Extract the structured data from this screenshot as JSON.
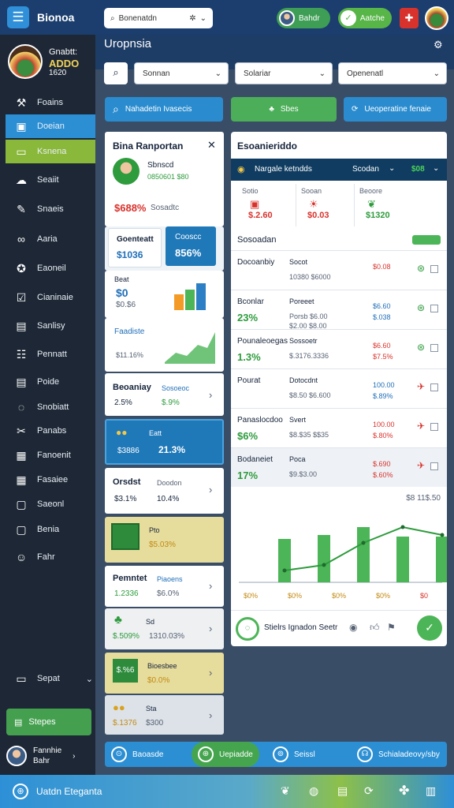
{
  "header": {
    "app_name": "Bionoa",
    "search_value": "Bonenatdn",
    "pill_a": "Bahdr",
    "pill_b": "Aatche"
  },
  "brand": {
    "line1": "Gnabtt:",
    "line2": "ADDO",
    "line3": "1620"
  },
  "sidebar": {
    "items": [
      {
        "label": "Foains",
        "icon": "wrench-icon",
        "glyph": "⚒"
      },
      {
        "label": "Doeian",
        "icon": "monitor-icon",
        "glyph": "▣"
      },
      {
        "label": "Ksnena",
        "icon": "laptop-icon",
        "glyph": "▭"
      },
      {
        "label": "Seaiit",
        "icon": "cloud-icon",
        "glyph": "☁"
      },
      {
        "label": "Snaeis",
        "icon": "pen-icon",
        "glyph": "✎"
      },
      {
        "label": "Aaria",
        "icon": "link-icon",
        "glyph": "∞"
      },
      {
        "label": "Eaoneil",
        "icon": "badge-icon",
        "glyph": "✪"
      },
      {
        "label": "Cianinaie",
        "icon": "report-icon",
        "glyph": "☑"
      },
      {
        "label": "Sanlisy",
        "icon": "folder-icon",
        "glyph": "▤"
      },
      {
        "label": "Pennatt",
        "icon": "checklist-icon",
        "glyph": "☷"
      },
      {
        "label": "Poide",
        "icon": "document-icon",
        "glyph": "▤"
      },
      {
        "label": "Snobiatt",
        "icon": "chat-icon",
        "glyph": "◌"
      },
      {
        "label": "Panabs",
        "icon": "tools-icon",
        "glyph": "✂"
      },
      {
        "label": "Fanoenit",
        "icon": "calendar-icon",
        "glyph": "▦"
      },
      {
        "label": "Fasaiee",
        "icon": "grid-icon",
        "glyph": "▦"
      },
      {
        "label": "Saeonl",
        "icon": "box-icon",
        "glyph": "▢"
      },
      {
        "label": "Benia",
        "icon": "square-icon",
        "glyph": "▢"
      },
      {
        "label": "Fahr",
        "icon": "person-icon",
        "glyph": "☺"
      }
    ],
    "group_label": "Sepat",
    "bottom_button": "Stepes",
    "user_name": "Fannhie",
    "user_sub": "Bahr"
  },
  "main": {
    "title": "Uropnsia",
    "filters": {
      "sel1": "Sonnan",
      "sel2": "Solariar",
      "sel3": "Openenatl"
    },
    "actions": {
      "a1": "Nahadetin Ivasecis",
      "a2": "Sbes",
      "a3": "Ueoperatine fenaie"
    }
  },
  "leftcol": {
    "profile": {
      "title": "Bina Ranportan",
      "name": "Sbnscd",
      "id": "0850601 $80",
      "big": "$688%",
      "big_sub": "Sosadtc"
    },
    "kpi_a": {
      "label": "Goenteatt",
      "value": "$1036"
    },
    "kpi_b": {
      "label": "Cooscc",
      "value": "856%"
    },
    "mini_chart": {
      "label": "Beat",
      "value": "$0",
      "sub": "$0.$6"
    },
    "trend": {
      "label": "Faadiste",
      "sub": "$11.16%"
    },
    "row1": {
      "title": "Beoaniay",
      "sub": "Sosoeoc",
      "v1": "2.5%",
      "v2": "$.9%"
    },
    "row2": {
      "label": "Eatt",
      "v1": "$3886",
      "v2": "21.3%"
    },
    "row3": {
      "title": "Orsdst",
      "sub": "Doodon",
      "v1": "$3.1%",
      "v2": "10.4%"
    },
    "row4": {
      "label": "Pto",
      "v1": "$5.03%"
    },
    "row5": {
      "title": "Pemntet",
      "sub": "Piaoens",
      "v1": "1.2336",
      "v2": "$6.0%"
    },
    "row6": {
      "label": "Sd",
      "v1": "$.509%",
      "v2": "1310.03%"
    },
    "row7": {
      "label": "Bioesbee",
      "v1": "$.%6",
      "v2": "$0.0%"
    },
    "row8": {
      "label": "Sta",
      "v1": "$.1376",
      "v2": "$300"
    }
  },
  "panel": {
    "title": "Esoanieriddo",
    "band_label": "Nargale ketndds",
    "band_sel": "Scodan",
    "band_value": "$08",
    "stats": [
      {
        "label": "Sotio",
        "value": "$.2.60",
        "color": "#d8322c"
      },
      {
        "label": "Sooan",
        "value": "$0.03",
        "color": "#d8322c"
      },
      {
        "label": "Beoore",
        "value": "$1320",
        "color": "#2e9b3d"
      }
    ],
    "section": "Sosoadan",
    "rows": [
      {
        "name": "Docoanbiy",
        "sub": "Socot",
        "pct": "",
        "mid": "10380 $6000",
        "right": "$0.08",
        "rcolor": "#d8322c",
        "icon": "green"
      },
      {
        "name": "Bconlar",
        "sub": "Poreeet",
        "pct": "23%",
        "mid": "Porsb $6.00 $2.00 $8.00",
        "right": "$6.60 $.038",
        "rcolor": "#1f6eb8",
        "icon": "green"
      },
      {
        "name": "Pounaleoegas",
        "sub": "Sossoetr",
        "pct": "1.3%",
        "mid": "$.3176.3336",
        "right": "$6.60 $7.5%",
        "rcolor": "#d8322c",
        "icon": "green"
      },
      {
        "name": "Pourat",
        "sub": "Dotocdnt",
        "pct": "",
        "mid": "$8.50 $6.600",
        "right": "100.00 $.89%",
        "rcolor": "#1f6eb8",
        "icon": "red"
      },
      {
        "name": "Panaslocdoo",
        "sub": "Svert",
        "pct": "$6%",
        "mid": "$8.$35 $$35",
        "right": "100.00 $.80%",
        "rcolor": "#d8322c",
        "icon": "red"
      },
      {
        "name": "Bodaneiet",
        "sub": "Poca",
        "pct": "17%",
        "mid": "$9.$3.00",
        "right": "$.690 $.60%",
        "rcolor": "#d8322c",
        "icon": "red"
      }
    ],
    "chart_top_value": "$8 11$.50",
    "chart_labels": [
      "$0%",
      "$0%",
      "$0%",
      "$0%",
      "$0"
    ],
    "footer": "Stielrs Ignadon Seetr"
  },
  "chart_data": {
    "type": "bar",
    "categories": [
      "",
      "",
      "",
      "",
      ""
    ],
    "values": [
      55,
      60,
      70,
      58,
      58
    ],
    "line": [
      15,
      22,
      50,
      70,
      60
    ],
    "title": "",
    "ylim": [
      0,
      100
    ]
  },
  "tabs": [
    {
      "label": "Baoasde",
      "glyph": "⊙"
    },
    {
      "label": "Uepiadde",
      "glyph": "⊕"
    },
    {
      "label": "Seissl",
      "glyph": "⊚"
    },
    {
      "label": "Schialadeovy/sby",
      "glyph": "☊"
    }
  ],
  "footer": {
    "title": "Uatdn Eteganta"
  },
  "colors": {
    "accent": "#2c8fd3",
    "green": "#4cb557",
    "red": "#d8322c",
    "sidebar": "#1d2735"
  }
}
